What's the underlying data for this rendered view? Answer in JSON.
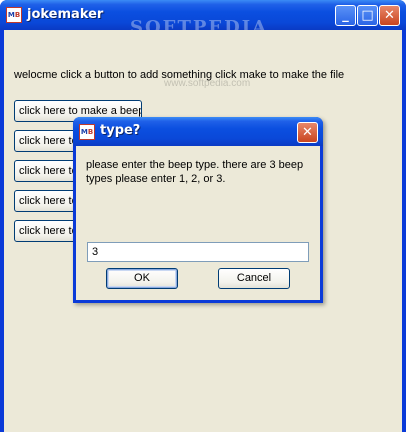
{
  "window": {
    "title": "jokemaker",
    "icon": "jm-app-icon",
    "icon_letters": [
      "M",
      "B"
    ],
    "controls": {
      "minimize": "_",
      "maximize": "□",
      "close": "✕"
    },
    "accent": "#0a3ad8"
  },
  "watermark": {
    "text": "SOFTPEDIA",
    "url": "www.softpedia.com"
  },
  "main": {
    "welcome": "welocme click a button to add something click make to make the file",
    "buttons": [
      "click here to make a beep",
      "click here to",
      "click here to",
      "click here to",
      "click here to"
    ]
  },
  "dialog": {
    "title": "type?",
    "message": "please enter the beep type. there are 3 beep types please enter 1, 2, or 3.",
    "input_value": "3",
    "ok_label": "OK",
    "cancel_label": "Cancel",
    "close_glyph": "✕"
  }
}
